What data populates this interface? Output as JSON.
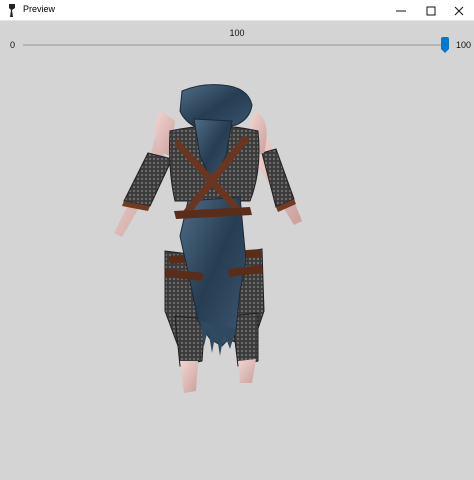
{
  "window": {
    "title": "Preview",
    "app_icon": "paintbrush-icon",
    "controls": [
      "minimize-icon",
      "maximize-icon",
      "close-icon"
    ]
  },
  "slider": {
    "value": "100",
    "min_label": "0",
    "max_label": "100",
    "position": 1.0,
    "accent_color": "#0078d4"
  },
  "preview": {
    "background_color": "#d4d4d4",
    "model": "armored figure with blue hooded scarf, leather straps and chainmail leggings"
  }
}
